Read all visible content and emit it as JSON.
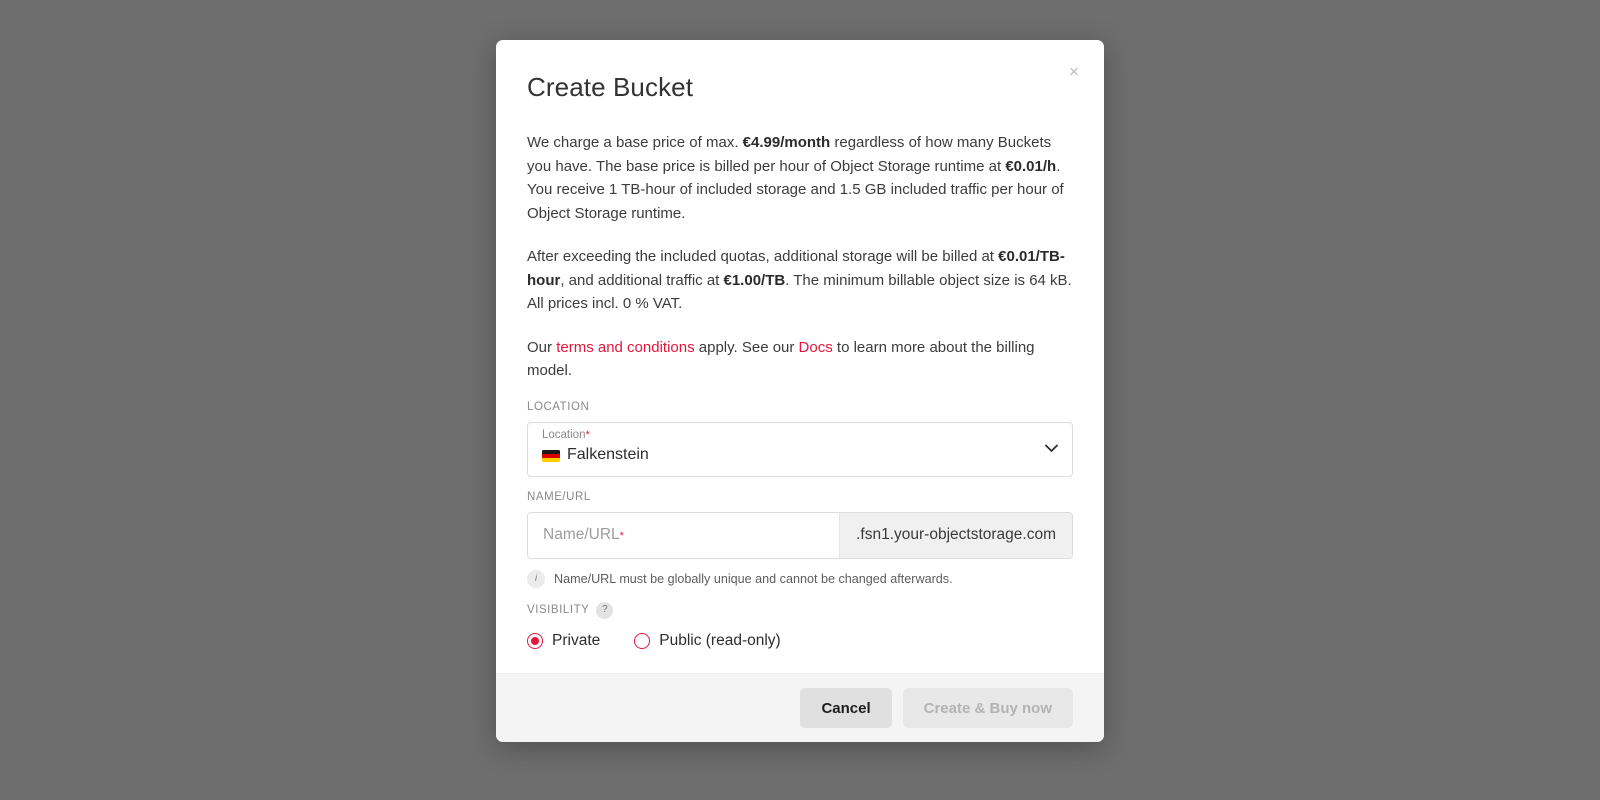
{
  "dialog": {
    "title": "Create Bucket",
    "close_label": "×",
    "paragraph1": {
      "part1": "We charge a base price of max. ",
      "bold1": "€4.99/month",
      "part2": " regardless of how many Buckets you have. The base price is billed per hour of Object Storage runtime at ",
      "bold2": "€0.01/h",
      "part3": ". You receive 1 TB-hour of included storage and 1.5 GB included traffic per hour of Object Storage runtime."
    },
    "paragraph2": {
      "part1": "After exceeding the included quotas, additional storage will be billed at ",
      "bold1": "€0.01/TB-hour",
      "part2": ", and additional traffic at ",
      "bold2": "€1.00/TB",
      "part3": ". The minimum billable object size is 64 kB. All prices incl. 0 % VAT."
    },
    "paragraph3": {
      "part1": "Our ",
      "link1": "terms and conditions",
      "part2": " apply. See our ",
      "link2": "Docs",
      "part3": " to learn more about the billing model."
    }
  },
  "location": {
    "section_label": "LOCATION",
    "floating_label": "Location",
    "required_marker": "*",
    "selected_value": "Falkenstein",
    "flag_icon": "flag-de-icon",
    "chevron_icon": "chevron-down-icon",
    "options": [
      "Falkenstein"
    ]
  },
  "name_url": {
    "section_label": "NAME/URL",
    "placeholder": "Name/URL",
    "required_marker": "*",
    "value": "",
    "suffix": ".fsn1.your-objectstorage.com",
    "hint_icon": "info-icon",
    "hint_text": "Name/URL must be globally unique and cannot be changed afterwards."
  },
  "visibility": {
    "section_label": "VISIBILITY",
    "help_badge": "?",
    "options": [
      {
        "label": "Private",
        "selected": true
      },
      {
        "label": "Public (read-only)",
        "selected": false
      }
    ]
  },
  "footer": {
    "cancel_label": "Cancel",
    "submit_label": "Create & Buy now"
  },
  "colors": {
    "accent_red": "#e3173e",
    "backdrop": "#6e6e6e",
    "footer_bg": "#f4f4f4",
    "suffix_bg": "#f0f0f0"
  }
}
